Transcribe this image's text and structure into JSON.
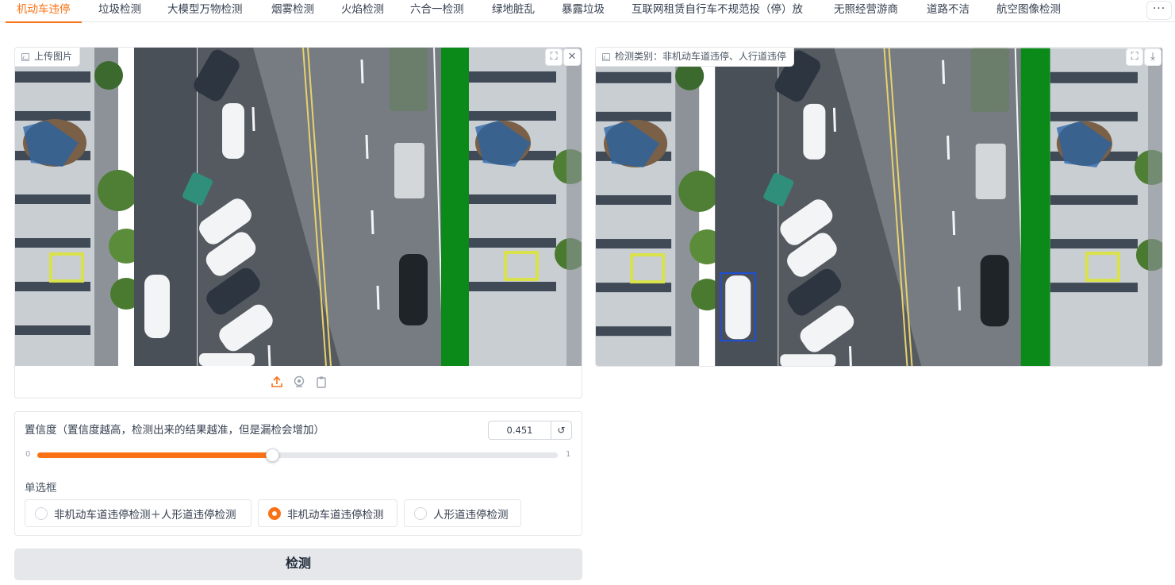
{
  "tabs": [
    {
      "label": "机动车违停",
      "active": true
    },
    {
      "label": "垃圾检测",
      "active": false
    },
    {
      "label": "大模型万物检测",
      "active": false
    },
    {
      "label": "烟雾检测",
      "active": false
    },
    {
      "label": "火焰检测",
      "active": false
    },
    {
      "label": "六合一检测",
      "active": false
    },
    {
      "label": "绿地脏乱",
      "active": false
    },
    {
      "label": "暴露垃圾",
      "active": false
    },
    {
      "label": "互联网租赁自行车不规范投（停）放",
      "active": false
    },
    {
      "label": "无照经营游商",
      "active": false
    },
    {
      "label": "道路不洁",
      "active": false
    },
    {
      "label": "航空图像检测",
      "active": false
    }
  ],
  "more_label": "···",
  "input_panel": {
    "label": "上传图片",
    "icons": [
      "fullscreen-icon",
      "close-icon"
    ],
    "source_icons": [
      "upload-icon",
      "webcam-icon",
      "clipboard-icon"
    ]
  },
  "output_panel": {
    "label": "检测类别：非机动车道违停、人行道违停",
    "icons": [
      "fullscreen-icon",
      "download-icon"
    ]
  },
  "slider": {
    "label": "置信度（置信度越高，检测出来的结果越准，但是漏检会增加）",
    "value": "0.451",
    "fraction": 0.451,
    "min": "0",
    "max": "1",
    "reset_glyph": "↺"
  },
  "radio_group": {
    "label": "单选框",
    "options": [
      {
        "label": "非机动车道违停检测＋人形道违停检测",
        "checked": false
      },
      {
        "label": "非机动车道违停检测",
        "checked": true
      },
      {
        "label": "人形道违停检测",
        "checked": false
      }
    ]
  },
  "detect_button": "检测",
  "colors": {
    "accent": "#f97316",
    "bbox": "#1d4ed8",
    "green_screen": "#0b8a1a"
  }
}
